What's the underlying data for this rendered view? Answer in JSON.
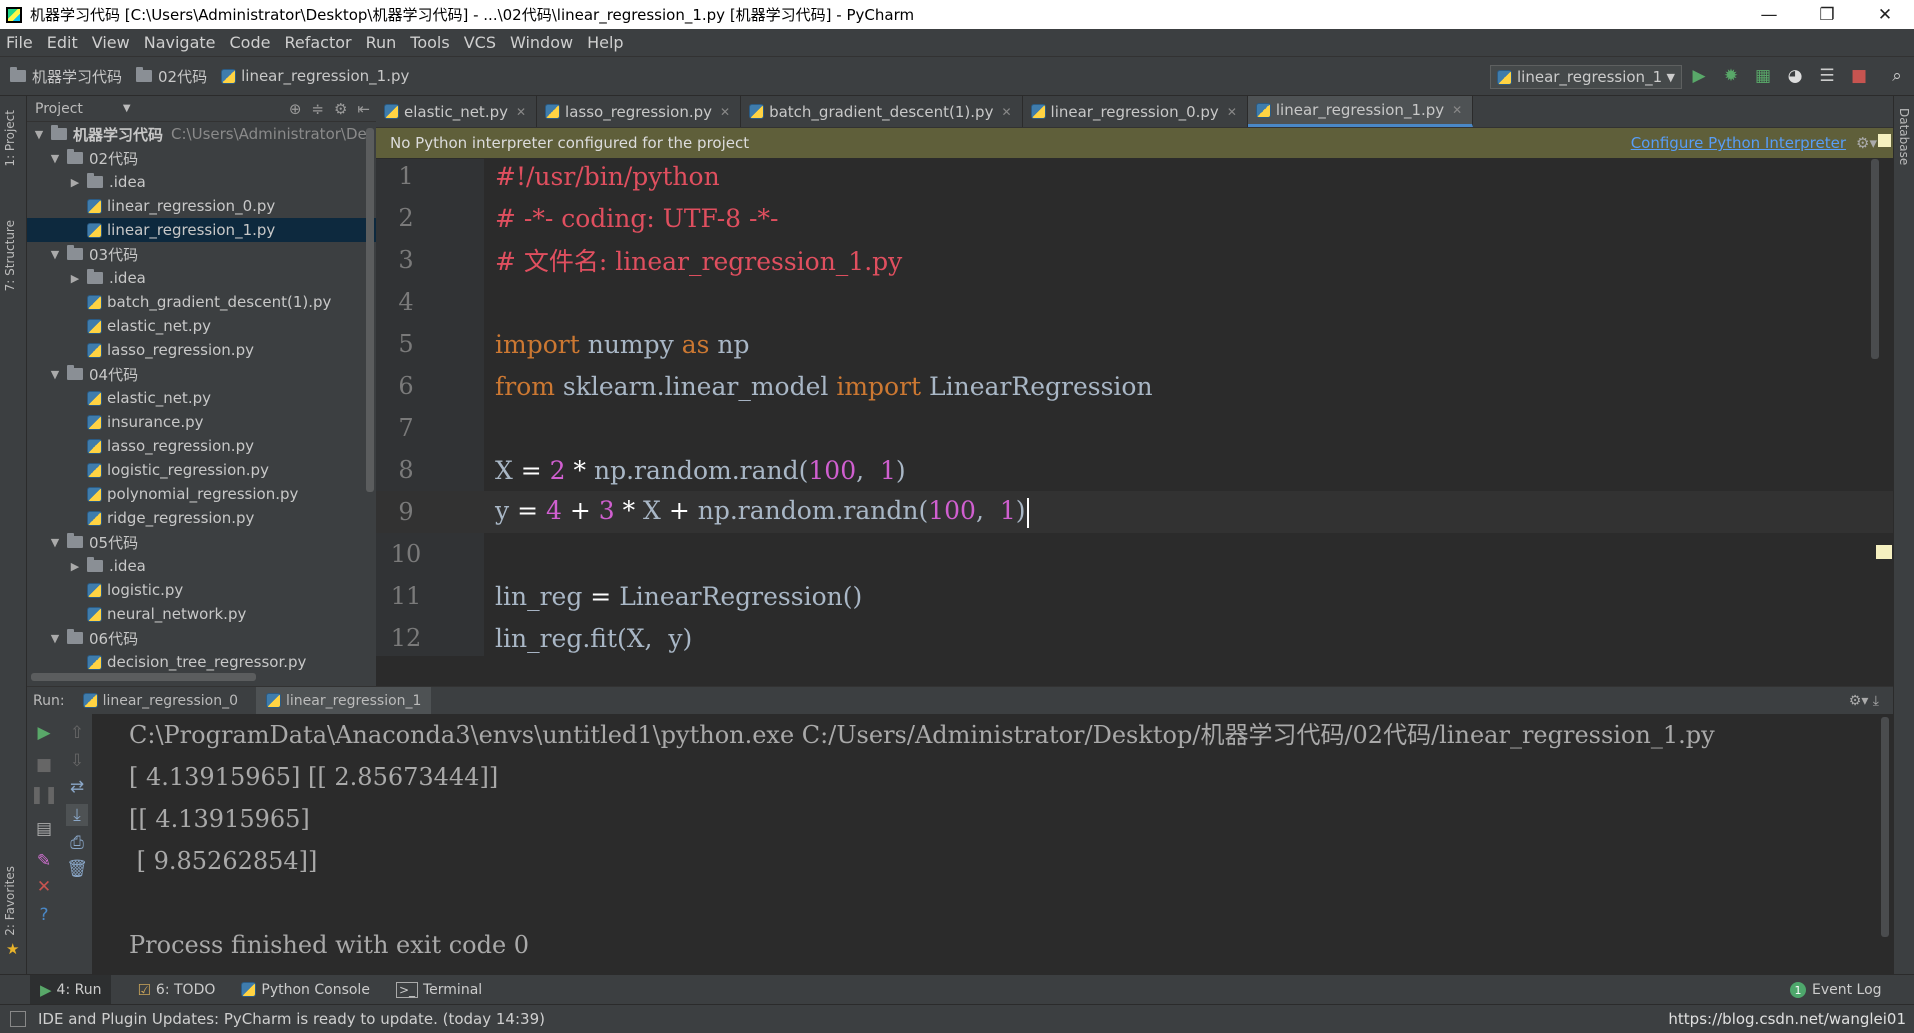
{
  "window": {
    "title": "机器学习代码 [C:\\Users\\Administrator\\Desktop\\机器学习代码] - ...\\02代码\\linear_regression_1.py [机器学习代码] - PyCharm",
    "min": "—",
    "restore": "❐",
    "close": "✕"
  },
  "menu": [
    "File",
    "Edit",
    "View",
    "Navigate",
    "Code",
    "Refactor",
    "Run",
    "Tools",
    "VCS",
    "Window",
    "Help"
  ],
  "breadcrumb": [
    "机器学习代码",
    "02代码",
    "linear_regression_1.py"
  ],
  "run_config": "linear_regression_1",
  "toolbar_icons": [
    "run-icon",
    "debug-icon",
    "coverage-icon",
    "profile-icon",
    "concurrency-icon",
    "stop-icon",
    "search-icon"
  ],
  "project_panel": {
    "title": "Project",
    "root_name": "机器学习代码",
    "root_path": "C:\\Users\\Administrator\\Des",
    "items": [
      {
        "label": "02代码",
        "type": "folder",
        "depth": 1,
        "open": true
      },
      {
        "label": ".idea",
        "type": "folder",
        "depth": 2,
        "open": false
      },
      {
        "label": "linear_regression_0.py",
        "type": "file",
        "depth": 2
      },
      {
        "label": "linear_regression_1.py",
        "type": "file",
        "depth": 2,
        "selected": true
      },
      {
        "label": "03代码",
        "type": "folder",
        "depth": 1,
        "open": true
      },
      {
        "label": ".idea",
        "type": "folder",
        "depth": 2,
        "open": false
      },
      {
        "label": "batch_gradient_descent(1).py",
        "type": "file",
        "depth": 2
      },
      {
        "label": "elastic_net.py",
        "type": "file",
        "depth": 2
      },
      {
        "label": "lasso_regression.py",
        "type": "file",
        "depth": 2
      },
      {
        "label": "04代码",
        "type": "folder",
        "depth": 1,
        "open": true
      },
      {
        "label": "elastic_net.py",
        "type": "file",
        "depth": 2
      },
      {
        "label": "insurance.py",
        "type": "file",
        "depth": 2
      },
      {
        "label": "lasso_regression.py",
        "type": "file",
        "depth": 2
      },
      {
        "label": "logistic_regression.py",
        "type": "file",
        "depth": 2
      },
      {
        "label": "polynomial_regression.py",
        "type": "file",
        "depth": 2
      },
      {
        "label": "ridge_regression.py",
        "type": "file",
        "depth": 2
      },
      {
        "label": "05代码",
        "type": "folder",
        "depth": 1,
        "open": true
      },
      {
        "label": ".idea",
        "type": "folder",
        "depth": 2,
        "open": false
      },
      {
        "label": "logistic.py",
        "type": "file",
        "depth": 2
      },
      {
        "label": "neural_network.py",
        "type": "file",
        "depth": 2
      },
      {
        "label": "06代码",
        "type": "folder",
        "depth": 1,
        "open": true
      },
      {
        "label": "decision_tree_regressor.py",
        "type": "file",
        "depth": 2
      }
    ]
  },
  "editor_tabs": [
    {
      "label": "elastic_net.py",
      "active": false
    },
    {
      "label": "lasso_regression.py",
      "active": false
    },
    {
      "label": "batch_gradient_descent(1).py",
      "active": false
    },
    {
      "label": "linear_regression_0.py",
      "active": false
    },
    {
      "label": "linear_regression_1.py",
      "active": true
    }
  ],
  "banner": {
    "message": "No Python interpreter configured for the project",
    "action": "Configure Python Interpreter"
  },
  "code_lines": [
    "#!/usr/bin/python",
    "# -*- coding: UTF-8 -*-",
    "# 文件名: linear_regression_1.py",
    "",
    "import numpy as np",
    "from sklearn.linear_model import LinearRegression",
    "",
    "X = 2 * np.random.rand(100,  1)",
    "y = 4 + 3 * X + np.random.randn(100,  1)",
    "",
    "lin_reg = LinearRegression()",
    "lin_reg.fit(X,  y)"
  ],
  "current_line": 9,
  "run_panel": {
    "label": "Run:",
    "tabs": [
      "linear_regression_0",
      "linear_regression_1"
    ],
    "active_tab": "linear_regression_1",
    "output": [
      "C:\\ProgramData\\Anaconda3\\envs\\untitled1\\python.exe C:/Users/Administrator/Desktop/机器学习代码/02代码/linear_regression_1.py",
      "[ 4.13915965] [[ 2.85673444]]",
      "[[ 4.13915965]",
      " [ 9.85262854]]",
      "",
      "Process finished with exit code 0"
    ]
  },
  "side_tabs": {
    "project": "1: Project",
    "structure": "7: Structure",
    "favorites": "2: Favorites",
    "database": "Database"
  },
  "bottom_tabs": [
    {
      "label": "4: Run",
      "icon": "run-icon",
      "active": true
    },
    {
      "label": "6: TODO",
      "icon": "todo-icon",
      "active": false
    },
    {
      "label": "Python Console",
      "icon": "python-console-icon",
      "active": false
    },
    {
      "label": "Terminal",
      "icon": "terminal-icon",
      "active": false
    }
  ],
  "event_log": {
    "label": "Event Log",
    "count": "1"
  },
  "status": {
    "message": "IDE and Plugin Updates: PyCharm is ready to update. (today 14:39)",
    "watermark": "https://blog.csdn.net/wanglei01"
  },
  "colors": {
    "keyword": "#cc7832",
    "comment": "#e04f5f",
    "number": "#d05fd0",
    "banner_bg": "#5f5f3a",
    "link": "#589df6",
    "selection": "#0d293e"
  }
}
